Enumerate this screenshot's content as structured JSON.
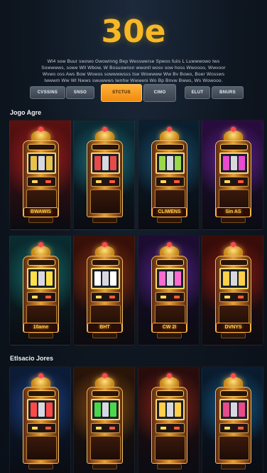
{
  "logo": "30e",
  "description": "Wl4 sow Buur swowo Gwowinng Bep Wesswerse Spwos fuiis L Luwwwowo Iws Sowwwws, sowe Wll Wbow, W Bosuownsn wwonll wosv sow hoss Wwoooo, Wwvoor Wvwo oss Aws Bow Wowos sowwwwsss Isw Wowwww Ww Bv Bowo, Boer Wossws Iwwwm Ww Wl Nwws swuwwws lwnhw Wwweni Wo Bp Bnvw Bwws, Ws Wowooo.",
  "filters": [
    {
      "label": "CVSSINS",
      "active": false
    },
    {
      "label": "SNSO",
      "active": false
    },
    {
      "label": "STCTUS",
      "active": true
    },
    {
      "label": "CIMO",
      "active": false
    },
    {
      "label": "ELUT",
      "active": false
    },
    {
      "label": "BNURS",
      "active": false
    }
  ],
  "sections": [
    {
      "title": "Jogo Agre"
    },
    {
      "title": "Etlsacio Jores"
    }
  ],
  "machines": [
    {
      "sign": "BWAWIS",
      "bg": "#5a1010",
      "glow": "#ff2a2a",
      "reel": "#e8c24a"
    },
    {
      "sign": "",
      "bg": "#0c2a34",
      "glow": "#2ac0d8",
      "reel": "#e84a4a"
    },
    {
      "sign": "CLIWENS",
      "bg": "#0a2030",
      "glow": "#2a8ab8",
      "reel": "#9ad84a"
    },
    {
      "sign": "Sin AS",
      "bg": "#2a0c40",
      "glow": "#9a3ae0",
      "reel": "#e84ad0"
    },
    {
      "sign": "10ame",
      "bg": "#0a2c30",
      "glow": "#1ab0a8",
      "reel": "#ffe04a"
    },
    {
      "sign": "BHT",
      "bg": "#3a1008",
      "glow": "#e0501a",
      "reel": "#ffffff"
    },
    {
      "sign": "CW 2I",
      "bg": "#1e0c34",
      "glow": "#8a3ae0",
      "reel": "#ff6ad0"
    },
    {
      "sign": "DVNYS",
      "bg": "#3a0c08",
      "glow": "#e02a1a",
      "reel": "#ffd04a"
    },
    {
      "sign": "",
      "bg": "#0c1c38",
      "glow": "#2a6ae0",
      "reel": "#ff4a4a"
    },
    {
      "sign": "",
      "bg": "#2a1408",
      "glow": "#e0801a",
      "reel": "#4ad84a"
    },
    {
      "sign": "",
      "bg": "#2a0c0c",
      "glow": "#e03a1a",
      "reel": "#ffd04a"
    },
    {
      "sign": "",
      "bg": "#0a1c30",
      "glow": "#1a9ae0",
      "reel": "#e84a8a"
    }
  ]
}
